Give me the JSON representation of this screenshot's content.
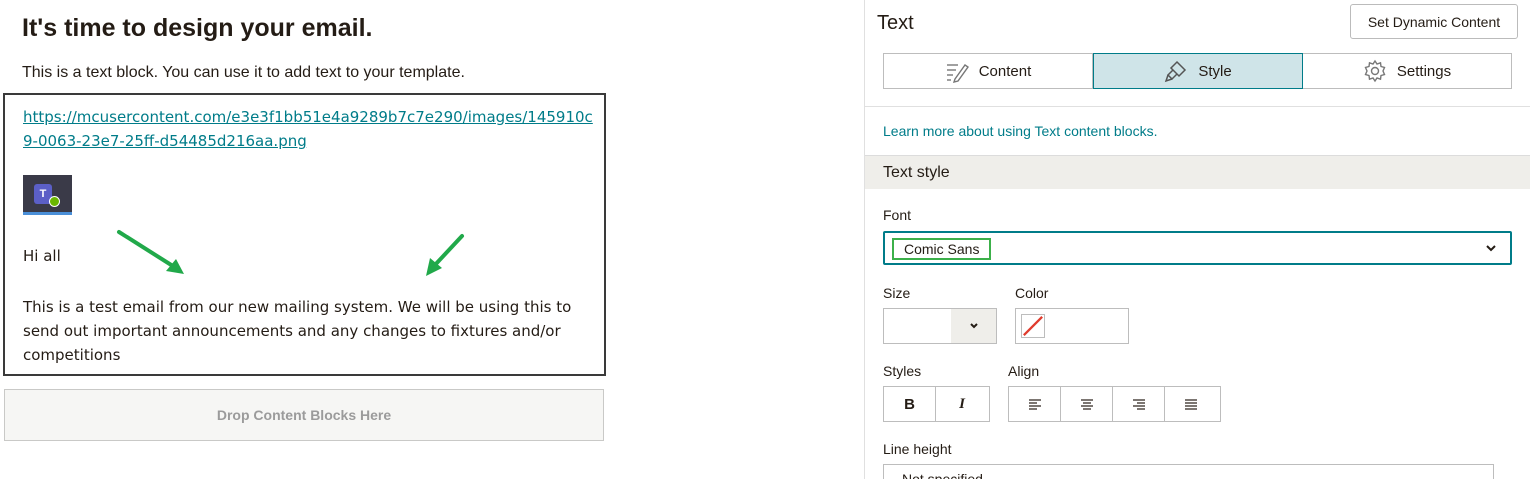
{
  "canvas": {
    "title": "It's time to design your email.",
    "intro": "This is a text block. You can use it to add text to your template.",
    "image_link": "https://mcusercontent.com/e3e3f1bb51e4a9289b7c7e290/images/145910c9-0063-23e7-25ff-d54485d216aa.png",
    "image_logo_letter": "T",
    "greeting": "Hi all",
    "body": "This is a test email from our new mailing system. We will be using this to send out important announcements and any changes to fixtures and/or competitions",
    "drop_zone": "Drop Content Blocks Here"
  },
  "panel": {
    "title": "Text",
    "dynamic_button": "Set Dynamic Content",
    "tabs": [
      {
        "label": "Content",
        "icon": "pencil-lines-icon",
        "active": false
      },
      {
        "label": "Style",
        "icon": "paint-brush-icon",
        "active": true
      },
      {
        "label": "Settings",
        "icon": "gear-icon",
        "active": false
      }
    ],
    "learn_link": "Learn more about using Text content blocks.",
    "section": "Text style",
    "font_label": "Font",
    "font_value": "Comic Sans",
    "size_label": "Size",
    "size_value": "",
    "color_label": "Color",
    "styles_label": "Styles",
    "bold": "B",
    "italic": "I",
    "align_label": "Align",
    "line_height_label": "Line height",
    "line_height_value": "Not specified"
  },
  "colors": {
    "accent": "#007c89",
    "active_tab_bg": "#cfe4e8",
    "highlight_green": "#3cb04a",
    "arrow_green": "#21a94a"
  }
}
